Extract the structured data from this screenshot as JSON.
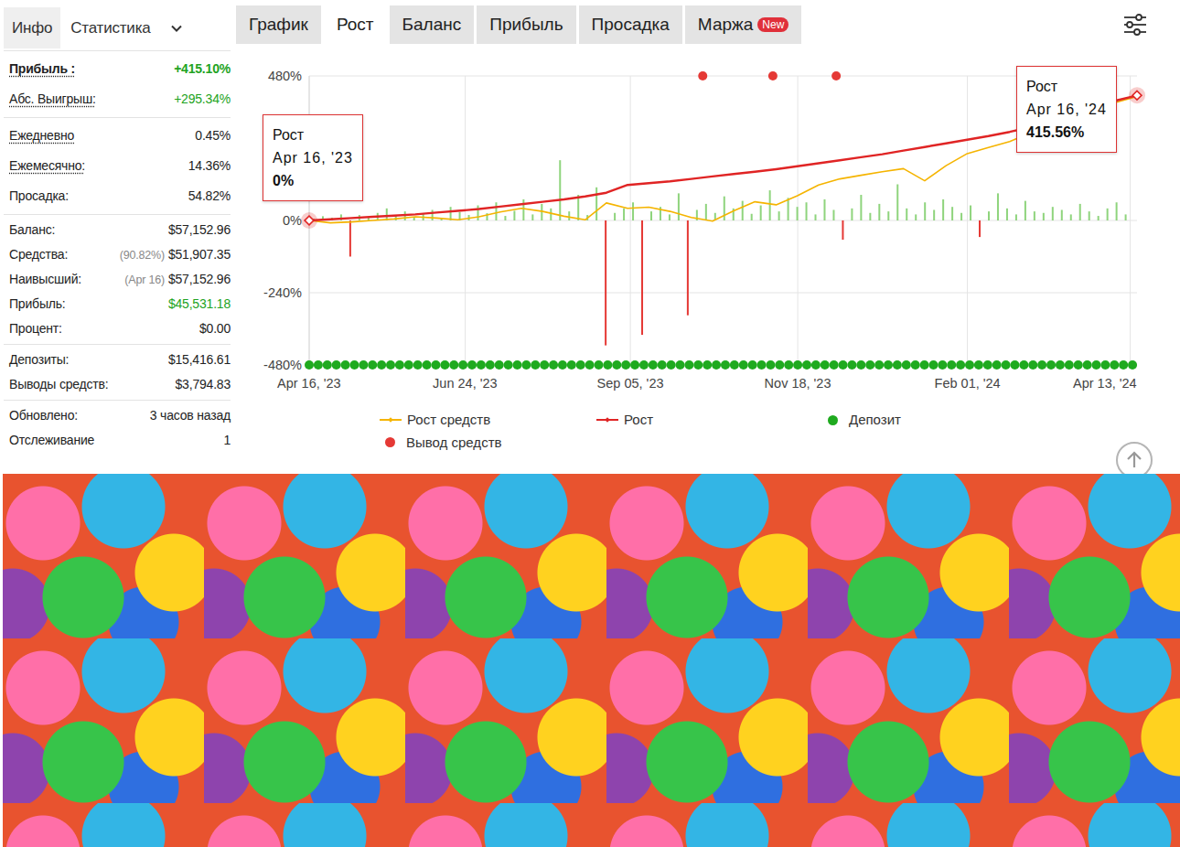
{
  "sidebar": {
    "tabs": [
      {
        "label": "Инфо",
        "selected": false
      },
      {
        "label": "Статистика",
        "selected": true
      }
    ],
    "groups": [
      [
        {
          "label": "Прибыль :",
          "value": "+415.10%",
          "kind": "strong",
          "color": "#22a322"
        },
        {
          "label": "Абс. Выигрыш:",
          "value": "+295.34%",
          "kind": "hint",
          "color": "#22a322"
        }
      ],
      [
        {
          "label": "Ежедневно",
          "value": "0.45%",
          "kind": "hint",
          "color": "#222222"
        },
        {
          "label": "Ежемесячно:",
          "value": "14.36%",
          "kind": "hint",
          "color": "#222222"
        },
        {
          "label": "Просадка:",
          "value": "54.82%",
          "kind": "plain",
          "color": "#222222"
        }
      ],
      [
        {
          "label": "Баланс:",
          "value": "$57,152.96",
          "kind": "plain",
          "color": "#222222"
        },
        {
          "label": "Средства:",
          "note": "(90.82%)",
          "value": "$51,907.35",
          "kind": "plain",
          "color": "#222222"
        },
        {
          "label": "Наивысший:",
          "note": "(Apr 16)",
          "value": "$57,152.96",
          "kind": "plain",
          "color": "#222222"
        },
        {
          "label": "Прибыль:",
          "value": "$45,531.18",
          "kind": "plain",
          "color": "#22a322"
        },
        {
          "label": "Процент:",
          "value": "$0.00",
          "kind": "plain",
          "color": "#222222"
        }
      ],
      [
        {
          "label": "Депозиты:",
          "value": "$15,416.61",
          "kind": "plain",
          "color": "#222222"
        },
        {
          "label": "Выводы средств:",
          "value": "$3,794.83",
          "kind": "plain",
          "color": "#222222"
        }
      ],
      [
        {
          "label": "Обновлено:",
          "value": "3 часов назад",
          "kind": "plain",
          "color": "#222222"
        },
        {
          "label": "Отслеживание",
          "value": "1",
          "kind": "plain",
          "color": "#222222"
        }
      ]
    ]
  },
  "chart": {
    "tabs": [
      {
        "label": "График",
        "selected": false
      },
      {
        "label": "Рост",
        "selected": true
      },
      {
        "label": "Баланс",
        "selected": false
      },
      {
        "label": "Прибыль",
        "selected": false
      },
      {
        "label": "Просадка",
        "selected": false
      },
      {
        "label": "Маржа",
        "selected": false,
        "badge": "New"
      }
    ],
    "y_ticks": [
      {
        "label": "480%",
        "value": 480
      },
      {
        "label": "0%",
        "value": 0
      },
      {
        "label": "-240%",
        "value": -240
      },
      {
        "label": "-480%",
        "value": -480
      }
    ],
    "x_ticks": [
      {
        "label": "Apr 16, '23",
        "day": 0
      },
      {
        "label": "Jun 24, '23",
        "day": 69
      },
      {
        "label": "Sep 05, '23",
        "day": 142
      },
      {
        "label": "Nov 18, '23",
        "day": 216
      },
      {
        "label": "Feb 01, '24",
        "day": 291
      },
      {
        "label": "Apr 13, '24",
        "day": 363
      }
    ],
    "series": [
      {
        "color": "#f5b400",
        "values": [
          0,
          -8,
          -5,
          0,
          5,
          12,
          8,
          2,
          12,
          28,
          40,
          30,
          14,
          2,
          58,
          40,
          44,
          30,
          10,
          -2,
          32,
          62,
          52,
          82,
          118,
          138,
          150,
          162,
          172,
          132,
          182,
          222,
          242,
          262,
          292,
          312,
          334,
          362,
          392,
          412
        ]
      },
      {
        "color": "#e02424",
        "values": [
          0,
          4,
          8,
          12,
          16,
          20,
          26,
          32,
          38,
          46,
          54,
          62,
          70,
          80,
          92,
          118,
          124,
          130,
          138,
          146,
          154,
          162,
          170,
          180,
          190,
          200,
          210,
          220,
          232,
          244,
          256,
          268,
          280,
          294,
          310,
          330,
          352,
          376,
          398,
          415
        ]
      }
    ],
    "daily": [
      6,
      14,
      9,
      20,
      -120,
      18,
      10,
      25,
      40,
      15,
      30,
      12,
      22,
      35,
      8,
      45,
      28,
      18,
      50,
      24,
      60,
      15,
      32,
      70,
      20,
      55,
      40,
      200,
      30,
      85,
      18,
      110,
      -415,
      25,
      40,
      60,
      -380,
      30,
      45,
      20,
      90,
      -315,
      35,
      55,
      25,
      80,
      40,
      65,
      22,
      50,
      100,
      30,
      75,
      45,
      60,
      20,
      70,
      35,
      -64,
      40,
      85,
      25,
      55,
      30,
      120,
      40,
      20,
      60,
      35,
      70,
      45,
      25,
      50,
      -55,
      30,
      90,
      40,
      20,
      65,
      30,
      25,
      45,
      35,
      20,
      55,
      30,
      15,
      40,
      60,
      20
    ],
    "withdrawals": [
      174,
      205,
      233
    ],
    "deposits": [
      0,
      4,
      8,
      12,
      16,
      20,
      24,
      28,
      32,
      36,
      40,
      44,
      48,
      52,
      56,
      60,
      64,
      68,
      72,
      76,
      80,
      84,
      88,
      92,
      96,
      100,
      104,
      108,
      112,
      116,
      120,
      124,
      128,
      132,
      136,
      140,
      144,
      148,
      152,
      156,
      160,
      164,
      168,
      172,
      176,
      180,
      184,
      188,
      192,
      196,
      200,
      204,
      208,
      212,
      216,
      220,
      224,
      228,
      232,
      236,
      240,
      244,
      248,
      252,
      256,
      260,
      264,
      268,
      272,
      276,
      280,
      284,
      288,
      292,
      296,
      300,
      304,
      308,
      312,
      316,
      320,
      324,
      328,
      332,
      336,
      340,
      344,
      348,
      352,
      356,
      360,
      364
    ],
    "tooltips": [
      {
        "title": "Рост",
        "date": "Apr 16, '23",
        "value": "0%",
        "day": 0,
        "level": 0
      },
      {
        "title": "Рост",
        "date": "Apr 16, '24",
        "value": "415.56%",
        "day": 366,
        "level": 415.56
      }
    ],
    "legend": [
      {
        "label": "Рост средств",
        "kind": "line",
        "color": "#f5b400"
      },
      {
        "label": "Рост",
        "kind": "line",
        "color": "#e02424"
      },
      {
        "label": "Депозит",
        "kind": "dot",
        "color": "#1faa1f"
      },
      {
        "label": "Вывод средств",
        "kind": "dot",
        "color": "#e53935"
      }
    ]
  }
}
